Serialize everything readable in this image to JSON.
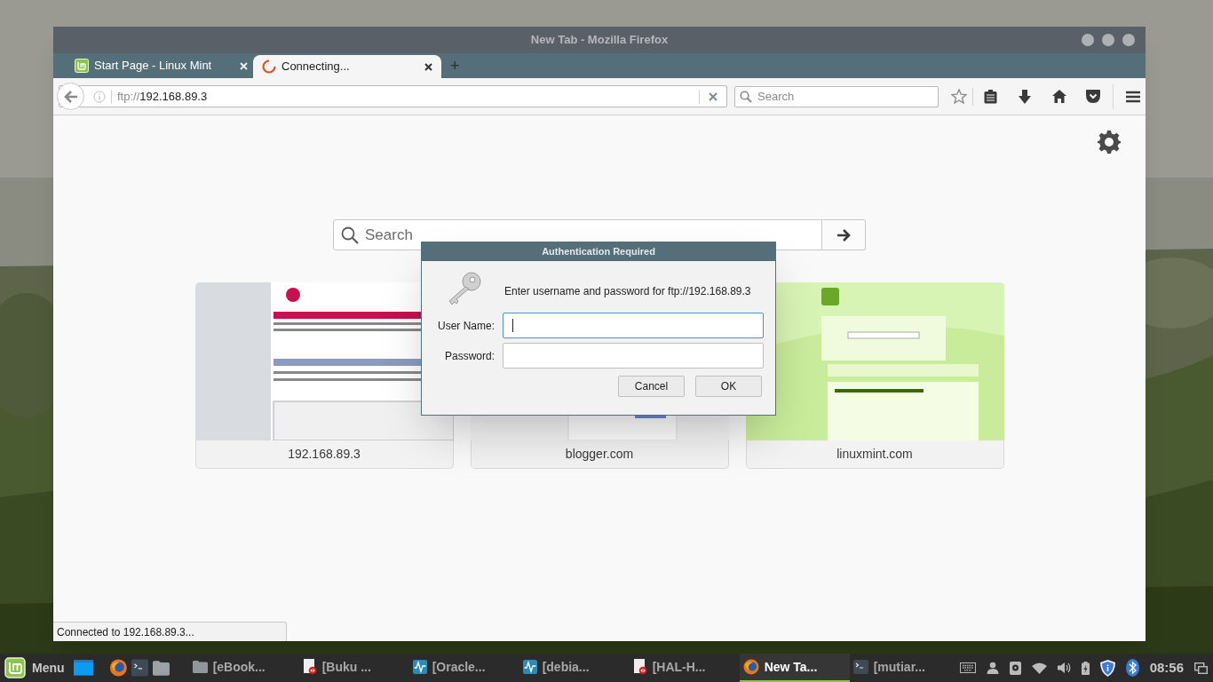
{
  "window": {
    "title": "New Tab - Mozilla Firefox"
  },
  "tabs": [
    {
      "label": "Start Page - Linux Mint",
      "selected": false,
      "kind": "mint"
    },
    {
      "label": "Connecting...",
      "selected": true,
      "kind": "loading"
    }
  ],
  "new_tab_button": "+",
  "address_bar": {
    "scheme": "ftp://",
    "host": "192.168.89.3"
  },
  "search_field": {
    "placeholder": "Search"
  },
  "new_tab_page": {
    "search": {
      "placeholder": "Search"
    },
    "tiles": [
      {
        "title": "192.168.89.3",
        "kind": "apache"
      },
      {
        "title": "blogger.com",
        "kind": "blank"
      },
      {
        "title": "linuxmint.com",
        "kind": "mint"
      }
    ]
  },
  "dialog": {
    "title": "Authentication Required",
    "message": "Enter username and password for ftp://192.168.89.3",
    "fields": [
      {
        "label": "User Name:",
        "focused": true
      },
      {
        "label": "Password:",
        "focused": false
      }
    ],
    "buttons": [
      "Cancel",
      "OK"
    ]
  },
  "status_bar": {
    "text": "Connected to 192.168.89.3..."
  },
  "taskbar": {
    "menu_label": "Menu",
    "tasks": [
      {
        "label": "[eBook...",
        "kind": "folder",
        "selected": false
      },
      {
        "label": "[Buku ...",
        "kind": "document",
        "selected": false
      },
      {
        "label": "[Oracle...",
        "kind": "monitor",
        "selected": false
      },
      {
        "label": "[debia...",
        "kind": "monitor",
        "selected": false
      },
      {
        "label": "[HAL-H...",
        "kind": "document",
        "selected": false
      },
      {
        "label": "New Ta...",
        "kind": "firefox",
        "selected": true
      },
      {
        "label": "[mutiar...",
        "kind": "terminal",
        "selected": false
      }
    ],
    "clock": "08:56"
  }
}
